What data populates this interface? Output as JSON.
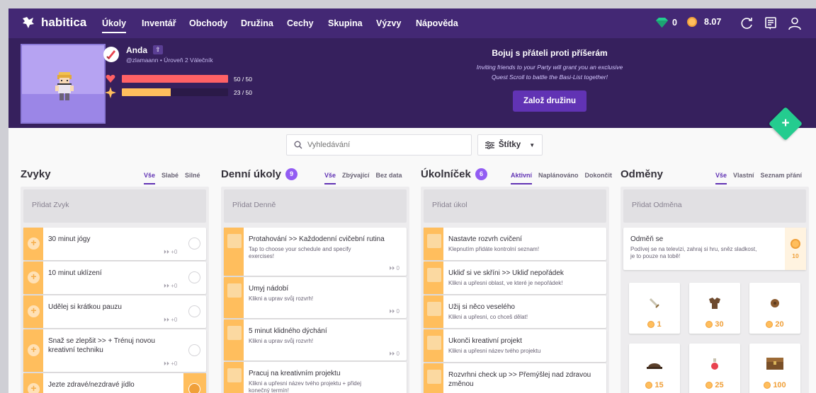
{
  "nav": {
    "brand": "habitica",
    "links": [
      "Úkoly",
      "Inventář",
      "Obchody",
      "Družina",
      "Cechy",
      "Skupina",
      "Výzvy",
      "Nápověda"
    ],
    "gems": "0",
    "gold": "8.07"
  },
  "user": {
    "name": "Anda",
    "subtitle": "@zlamaann • Úroveň 2 Válečník",
    "hp": {
      "label": "50 / 50",
      "fraction": 1.0
    },
    "xp": {
      "label": "23 / 50",
      "fraction": 0.46
    }
  },
  "party": {
    "title": "Bojuj s přáteli proti příšerám",
    "text_line1": "Inviting friends to your Party will grant you an exclusive",
    "text_line2": "Quest Scroll to battle the Basi-List together!",
    "button": "Založ družinu"
  },
  "search": {
    "placeholder": "Vyhledávání",
    "tags_label": "Štítky"
  },
  "habits": {
    "title": "Zvyky",
    "filters": [
      "Vše",
      "Slabé",
      "Silné"
    ],
    "add": "Přidat Zvyk",
    "items": [
      {
        "title": "30 minut jógy",
        "streak": "+0"
      },
      {
        "title": "10 minut uklízení",
        "streak": "+0"
      },
      {
        "title": "Udělej si krátkou pauzu",
        "streak": "+0"
      },
      {
        "title": "Snaž se zlepšit >> + Trénuj novou",
        "title2": "kreativní techniku",
        "streak": "+0"
      },
      {
        "title": "Jezte zdravé/nezdravé jídlo"
      }
    ]
  },
  "dailies": {
    "title": "Denní úkoly",
    "count": "9",
    "filters": [
      "Vše",
      "Zbývající",
      "Bez data"
    ],
    "add": "Přidat Denně",
    "items": [
      {
        "title": "Protahování >> Každodenní cvičební rutina",
        "notes1": "Tap to choose your schedule and specify",
        "notes2": "exercises!",
        "streak": "0"
      },
      {
        "title": "Umyj nádobí",
        "notes1": "Klikni a uprav svůj rozvrh!",
        "streak": "0"
      },
      {
        "title": "5 minut klidného dýchání",
        "notes1": "Klikni a uprav svůj rozvrh!",
        "streak": "0"
      },
      {
        "title": "Pracuj na kreativním projektu",
        "notes1": "Klikni a upřesni název tvého projektu + přidej",
        "notes2": "konečný termín!"
      }
    ]
  },
  "todos": {
    "title": "Úkolníček",
    "count": "6",
    "filters": [
      "Aktivní",
      "Naplánováno",
      "Dokončit"
    ],
    "add": "Přidat úkol",
    "items": [
      {
        "title": "Nastavte rozvrh cvičení",
        "notes1": "Klepnutím přidáte kontrolní seznam!"
      },
      {
        "title": "Ukliď si ve skříni >> Ukliď nepořádek",
        "notes1": "Klikni a upřesni oblast, ve které je nepořádek!"
      },
      {
        "title": "Užij si něco veselého",
        "notes1": "Klikni a upřesni, co chceš dělat!"
      },
      {
        "title": "Ukonči kreativní projekt",
        "notes1": "Klikni a upřesni název tvého projektu"
      },
      {
        "title": "Rozvrhni check up >> Přemýšlej nad zdravou",
        "title2": "změnou"
      }
    ]
  },
  "rewards": {
    "title": "Odměny",
    "filters": [
      "Vše",
      "Vlastní",
      "Seznam přání"
    ],
    "add": "Přidat Odměna",
    "custom": {
      "title": "Odměň se",
      "notes1": "Podívej se na televizi, zahraj si hru, sněz sladkost,",
      "notes2": "je to pouze na tobě!",
      "price": "10"
    },
    "shop": [
      {
        "icon": "sword-icon",
        "price": "1"
      },
      {
        "icon": "armor-icon",
        "price": "30"
      },
      {
        "icon": "shield-icon",
        "price": "20"
      },
      {
        "icon": "helmet-icon",
        "price": "15"
      },
      {
        "icon": "potion-icon",
        "price": "25"
      },
      {
        "icon": "chest-icon",
        "price": "100"
      }
    ]
  },
  "colors": {
    "nav": "#432874",
    "header": "#36205d",
    "habit": "#ffbe5d",
    "accent": "#6133b4",
    "fab": "#24cc8f",
    "badge": "#925cf3"
  }
}
